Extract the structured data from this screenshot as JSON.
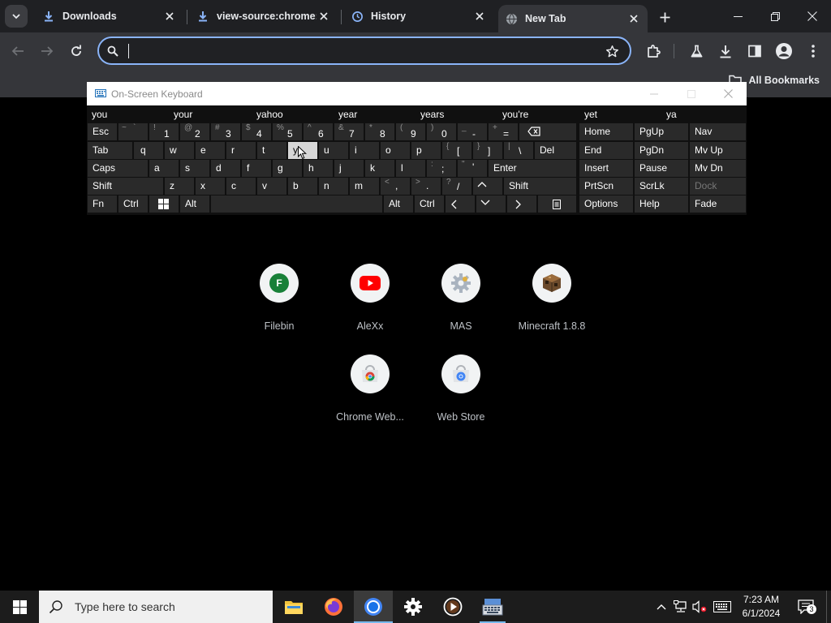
{
  "browser": {
    "tabs": [
      {
        "title": "Downloads",
        "icon": "download-icon",
        "active": false
      },
      {
        "title": "view-source:chrome://",
        "icon": "download-icon",
        "active": false
      },
      {
        "title": "History",
        "icon": "history-icon",
        "active": false
      },
      {
        "title": "New Tab",
        "icon": "globe-icon",
        "active": true
      }
    ],
    "omnibox": {
      "value": "",
      "placeholder": ""
    },
    "bookmarks": {
      "all_label": "All Bookmarks"
    },
    "accent": "#8ab4f8"
  },
  "keyboard": {
    "title": "On-Screen Keyboard",
    "suggestions": [
      "you",
      "your",
      "yahoo",
      "year",
      "years",
      "you're",
      "yet",
      "ya"
    ],
    "rows": {
      "r1": {
        "esc": "Esc",
        "k1s": "!",
        "k1": "1",
        "k2s": "@",
        "k2": "2",
        "k3s": "#",
        "k3": "3",
        "k4s": "$",
        "k4": "4",
        "k5s": "%",
        "k5": "5",
        "k6s": "^",
        "k6": "6",
        "k7s": "&",
        "k7": "7",
        "k8s": "*",
        "k8": "8",
        "k9s": "(",
        "k9": "9",
        "k0s": ")",
        "k0": "0",
        "minus_s": "_",
        "minus": "-",
        "plus_s": "+",
        "plus": "=",
        "tildes": "~",
        "tilde": "`"
      },
      "r2": {
        "tab": "Tab",
        "q": "q",
        "w": "w",
        "e": "e",
        "r": "r",
        "t": "t",
        "y": "y",
        "u": "u",
        "i": "i",
        "o": "o",
        "p": "p",
        "lb_s": "{",
        "lb": "[",
        "rb_s": "}",
        "rb": "]",
        "bs_s": "|",
        "bs": "\\",
        "del": "Del"
      },
      "r3": {
        "caps": "Caps",
        "a": "a",
        "s": "s",
        "d": "d",
        "f": "f",
        "g": "g",
        "h": "h",
        "j": "j",
        "k": "k",
        "l": "l",
        "semi_s": ":",
        "semi": ";",
        "quote_s": "\"",
        "quote": "'",
        "enter": "Enter"
      },
      "r4": {
        "shift": "Shift",
        "z": "z",
        "x": "x",
        "c": "c",
        "v": "v",
        "b": "b",
        "n": "n",
        "m": "m",
        "comma_s": "<",
        "comma": ",",
        "period_s": ">",
        "period": ".",
        "slash_s": "?",
        "slash": "/",
        "shift_r": "Shift"
      },
      "r5": {
        "fn": "Fn",
        "ctrl": "Ctrl",
        "alt": "Alt",
        "alt_r": "Alt",
        "ctrl_r": "Ctrl"
      },
      "nav": {
        "home": "Home",
        "pgup": "PgUp",
        "nav": "Nav",
        "end": "End",
        "pgdn": "PgDn",
        "mvup": "Mv Up",
        "insert": "Insert",
        "pause": "Pause",
        "mvdn": "Mv Dn",
        "prtscn": "PrtScn",
        "scrlk": "ScrLk",
        "dock": "Dock",
        "options": "Options",
        "help": "Help",
        "fade": "Fade"
      }
    },
    "highlighted_key": "y"
  },
  "shortcuts": [
    {
      "label": "Filebin",
      "icon": "filebin-icon",
      "letter": "F"
    },
    {
      "label": "AleXx",
      "icon": "youtube-icon"
    },
    {
      "label": "MAS",
      "icon": "gear-icon"
    },
    {
      "label": "Minecraft 1.8.8",
      "icon": "minecraft-icon"
    },
    {
      "label": "Chrome Web...",
      "icon": "chrome-web-store-icon"
    },
    {
      "label": "Web Store",
      "icon": "web-store-icon"
    }
  ],
  "taskbar": {
    "search_placeholder": "Type here to search",
    "time": "7:23 AM",
    "date": "6/1/2024",
    "notification_count": "3"
  }
}
